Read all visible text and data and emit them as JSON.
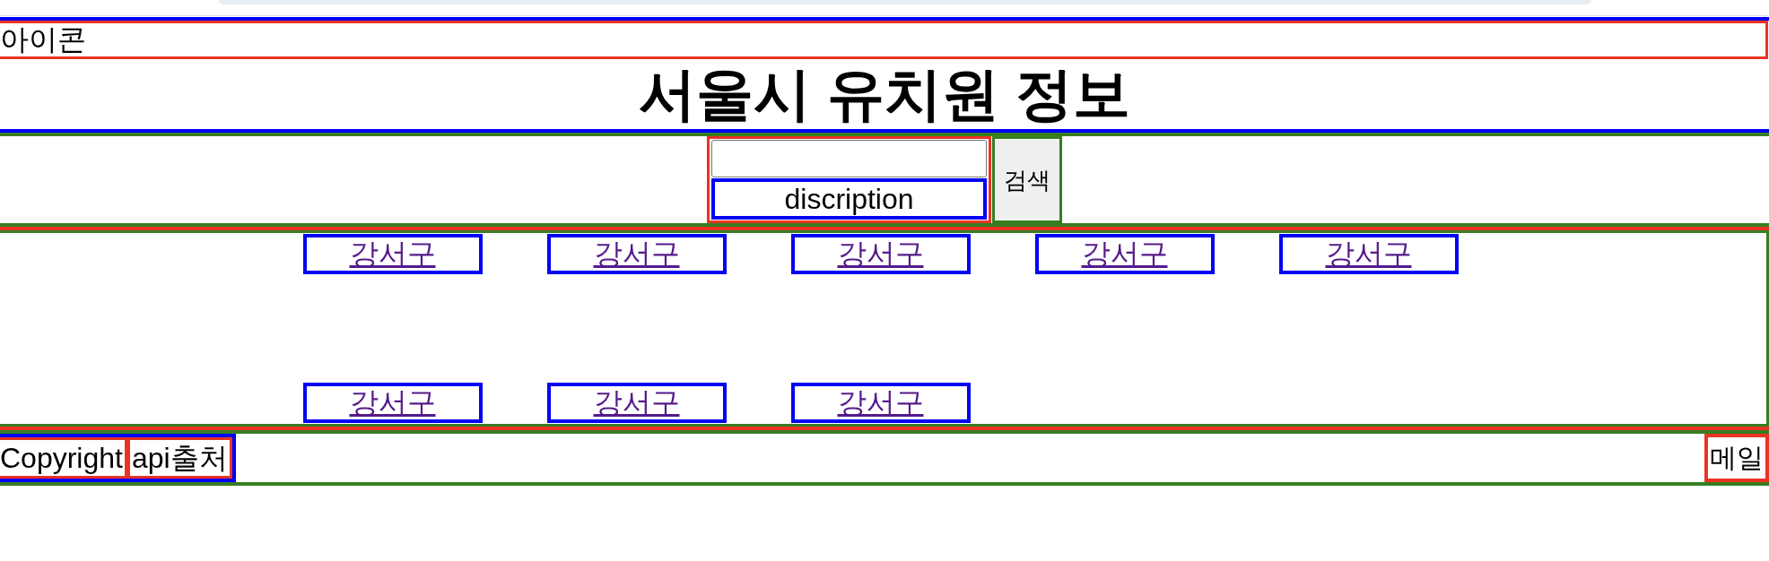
{
  "header": {
    "icon_label": "아이콘",
    "title": "서울시 유치원 정보"
  },
  "search": {
    "description": "discription",
    "button": "검색"
  },
  "districts": [
    {
      "label": "강서구",
      "visited": true
    },
    {
      "label": "강서구",
      "visited": true
    },
    {
      "label": "강서구",
      "visited": true
    },
    {
      "label": "강서구",
      "visited": true
    },
    {
      "label": "강서구",
      "visited": true
    },
    {
      "label": "강서구",
      "visited": true
    },
    {
      "label": "강서구",
      "visited": true
    },
    {
      "label": "강서구",
      "visited": true
    }
  ],
  "footer": {
    "copyright": "Copyright",
    "api_source": "api출처",
    "mail": "메일"
  }
}
